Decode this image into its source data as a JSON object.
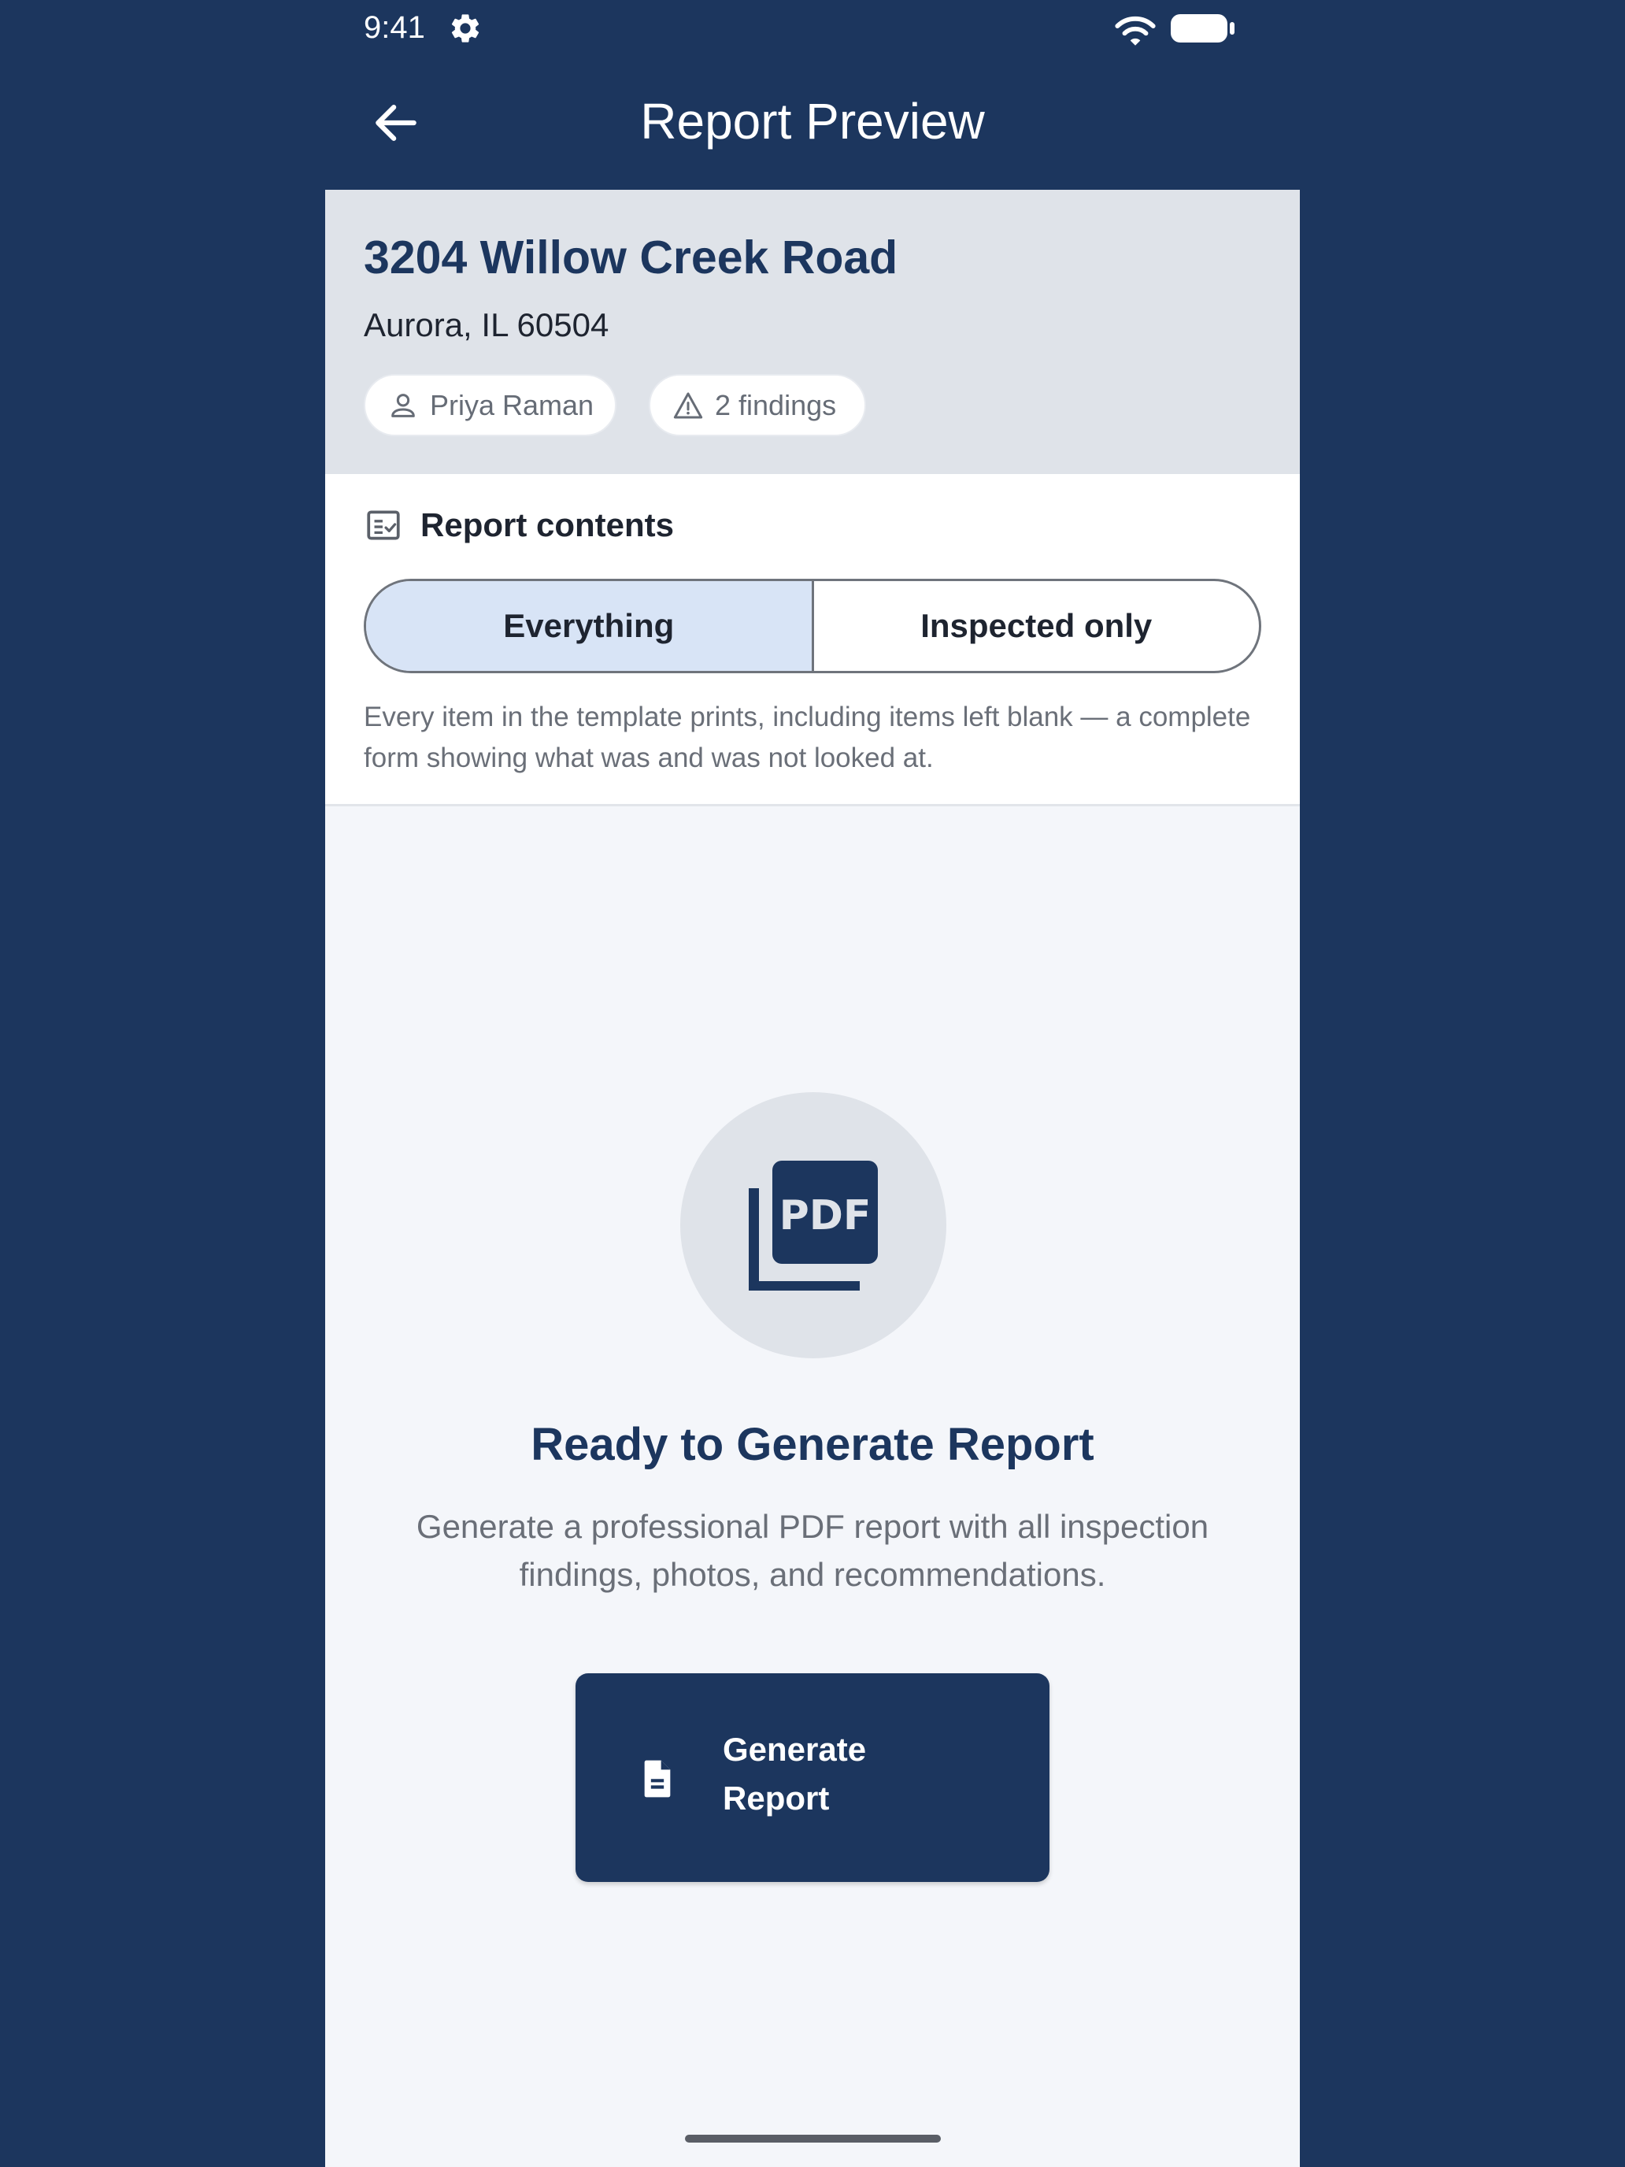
{
  "status_bar": {
    "time": "9:41",
    "icons": [
      "gear-icon",
      "wifi-icon",
      "battery-icon"
    ]
  },
  "app_bar": {
    "title": "Report Preview",
    "back_icon": "arrow-left-icon"
  },
  "property": {
    "address": "3204 Willow Creek Road",
    "city_state_zip": "Aurora, IL 60504",
    "inspector": "Priya Raman",
    "findings": "2 findings"
  },
  "report_contents": {
    "title": "Report contents",
    "options": [
      "Everything",
      "Inspected only"
    ],
    "selected": "Everything",
    "description": "Every item in the template prints, including items left blank — a complete form showing what was and was not looked at."
  },
  "empty_state": {
    "icon": "pdf-icon",
    "title": "Ready to Generate Report",
    "description": "Generate a professional PDF report with all inspection findings, photos, and recommendations.",
    "button_label": "Generate Report"
  },
  "colors": {
    "primary": "#1c365e",
    "header_bg": "#dfe3e9",
    "segment_active": "#d8e4f6",
    "page_bg": "#f4f6fa"
  }
}
